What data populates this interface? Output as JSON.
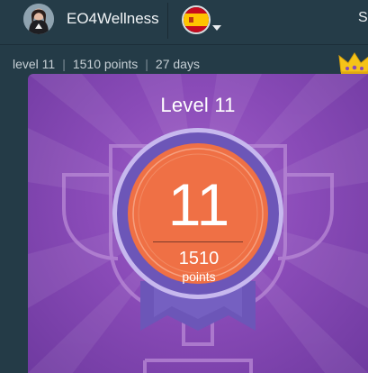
{
  "header": {
    "username": "EO4Wellness",
    "language_flag": "spain-flag-icon",
    "cut_text": "S"
  },
  "stats": {
    "level": "level 11",
    "points": "1510 points",
    "days": "27 days"
  },
  "modal": {
    "title": "Level 11",
    "level_number": "11",
    "points_value": "1510",
    "points_label": "points"
  },
  "colors": {
    "header_bg": "#253c48",
    "modal_purple": "#8a4bb8",
    "medal_orange": "#ef7045",
    "medal_ring": "#6c56b8",
    "crown_gold": "#f5c318"
  }
}
